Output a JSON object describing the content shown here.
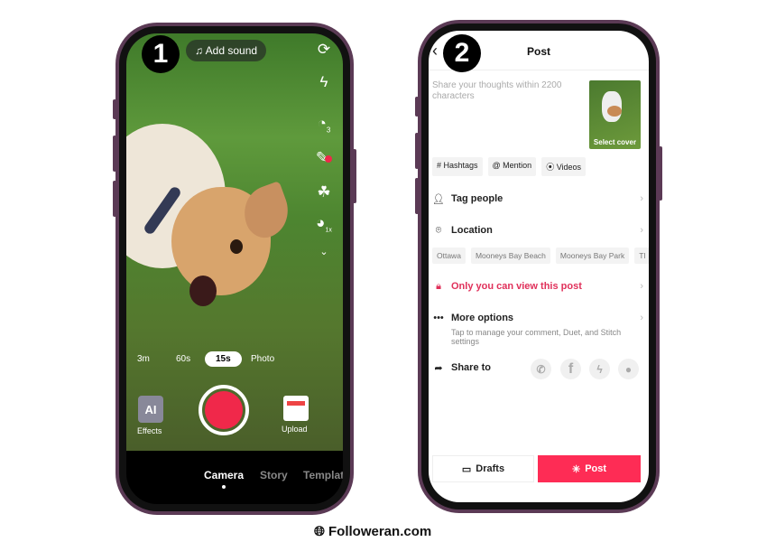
{
  "step_badges": [
    "1",
    "2"
  ],
  "camera": {
    "add_sound": "Add sound",
    "add_sound_icon": "music-note-icon",
    "right_toolbar": [
      "flip-camera-icon",
      "flash-off-icon",
      "timer-icon",
      "beauty-icon",
      "filters-icon",
      "speed-icon",
      "chevron-down-icon"
    ],
    "timer_value": "3",
    "speed_value": "1x",
    "durations": [
      "3m",
      "60s",
      "15s",
      "Photo"
    ],
    "selected_duration": "15s",
    "effects_label": "Effects",
    "effects_thumb_text": "AI",
    "upload_label": "Upload",
    "record_color": "#f0284a",
    "bottom_tabs": [
      "Camera",
      "Story",
      "Templat"
    ],
    "active_tab": "Camera"
  },
  "post": {
    "title": "Post",
    "caption_placeholder": "Share your thoughts within 2200 characters",
    "select_cover": "Select cover",
    "chips": [
      "# Hashtags",
      "@ Mention",
      "⦿ Videos"
    ],
    "tag_people": "Tag people",
    "location": "Location",
    "location_suggestions": [
      "Ottawa",
      "Mooneys Bay Beach",
      "Mooneys Bay Park",
      "Tl"
    ],
    "privacy": "Only you can view this post",
    "more_options": "More options",
    "more_options_sub": "Tap to manage your comment, Duet, and Stitch settings",
    "share_to": "Share to",
    "share_targets": [
      "whatsapp-icon",
      "facebook-icon",
      "messenger-icon",
      "sms-icon"
    ],
    "drafts": "Drafts",
    "post_button": "Post",
    "accent": "#fe2c55"
  },
  "footer": {
    "brand": "Followeran.com"
  }
}
